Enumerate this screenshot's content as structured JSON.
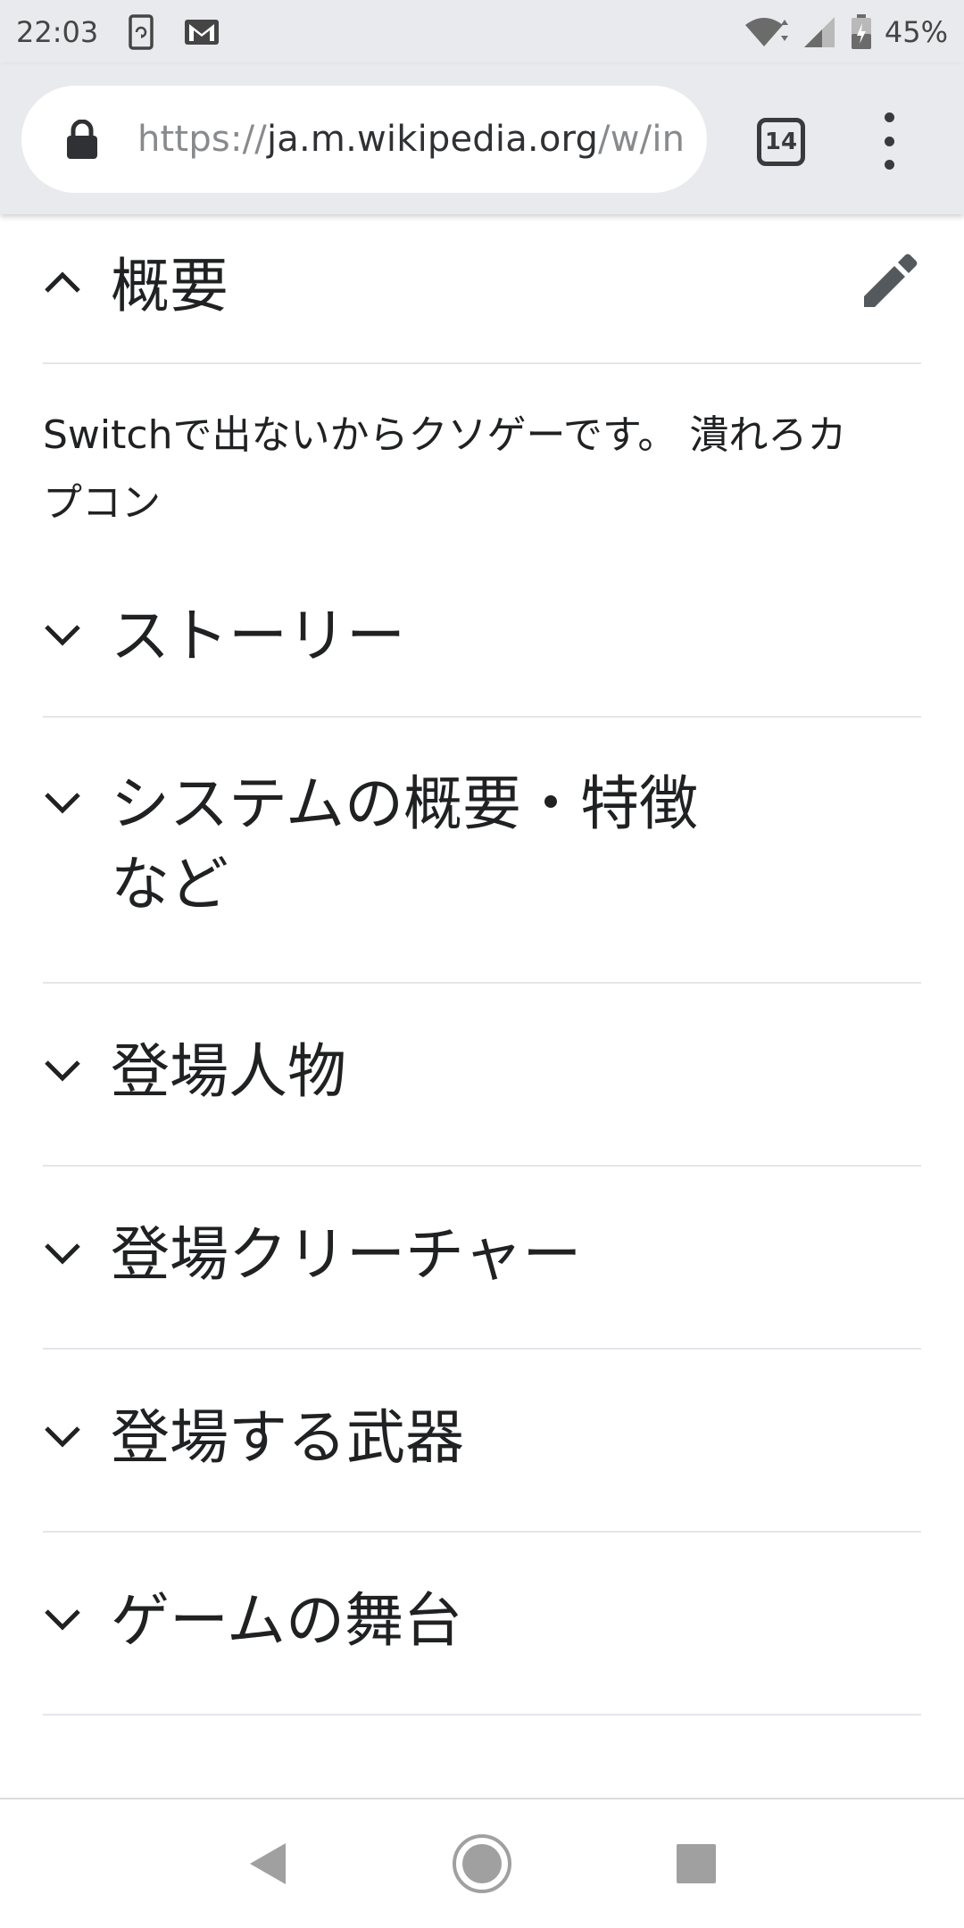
{
  "status_bar": {
    "time": "22:03",
    "battery": "45%",
    "icons": [
      "sync-icon",
      "gmail-icon",
      "wifi-icon",
      "signal-icon",
      "battery-icon"
    ]
  },
  "browser": {
    "url_scheme": "https://",
    "url_host": "ja.m.wikipedia.org",
    "url_path": "/w/index",
    "tab_count": "14"
  },
  "article": {
    "sections": [
      {
        "title": "概要",
        "expanded": true
      },
      {
        "title": "ストーリー",
        "expanded": false
      },
      {
        "title_line1": "システムの概要・特徴",
        "title_line2": "など",
        "expanded": false
      },
      {
        "title": "登場人物",
        "expanded": false
      },
      {
        "title": "登場クリーチャー",
        "expanded": false
      },
      {
        "title": "登場する武器",
        "expanded": false
      },
      {
        "title": "ゲームの舞台",
        "expanded": false
      }
    ],
    "overview_text_line1": "Switchで出ないからクソゲーです。 潰れろカ",
    "overview_text_line2": "プコン"
  },
  "colors": {
    "chrome_bg": "#e9eaee",
    "divider": "#e4e6ea",
    "text": "#202122",
    "icon": "#54595d"
  }
}
